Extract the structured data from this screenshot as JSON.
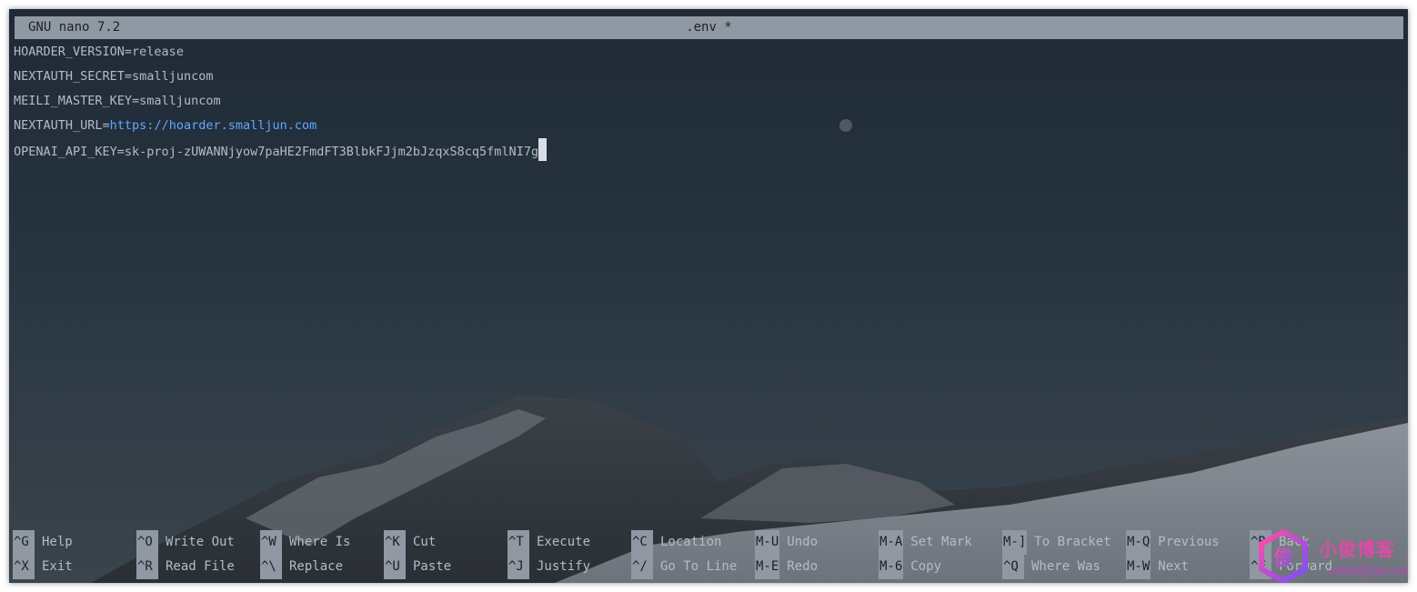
{
  "titlebar": {
    "app": "GNU nano 7.2",
    "file": ".env *"
  },
  "editor": {
    "lines": [
      {
        "key": "HOARDER_VERSION=",
        "value": "release"
      },
      {
        "key": "NEXTAUTH_SECRET=",
        "value": "smalljuncom"
      },
      {
        "key": "MEILI_MASTER_KEY=",
        "value": "smalljuncom"
      },
      {
        "key": "NEXTAUTH_URL=",
        "value": "https://hoarder.smalljun.com"
      },
      {
        "key": "OPENAI_API_KEY=",
        "value": "sk-proj-zUWANNjyow7paHE2FmdFT3BlbkFJjm2bJzqxS8cq5fmlNI7g"
      }
    ]
  },
  "shortcuts": {
    "row1": [
      {
        "key": "^G",
        "label": "Help"
      },
      {
        "key": "^O",
        "label": "Write Out"
      },
      {
        "key": "^W",
        "label": "Where Is"
      },
      {
        "key": "^K",
        "label": "Cut"
      },
      {
        "key": "^T",
        "label": "Execute"
      },
      {
        "key": "^C",
        "label": "Location"
      },
      {
        "key": "M-U",
        "label": "Undo"
      },
      {
        "key": "M-A",
        "label": "Set Mark"
      },
      {
        "key": "M-]",
        "label": "To Bracket"
      },
      {
        "key": "M-Q",
        "label": "Previous"
      },
      {
        "key": "^B",
        "label": "Back"
      }
    ],
    "row2": [
      {
        "key": "^X",
        "label": "Exit"
      },
      {
        "key": "^R",
        "label": "Read File"
      },
      {
        "key": "^\\",
        "label": "Replace"
      },
      {
        "key": "^U",
        "label": "Paste"
      },
      {
        "key": "^J",
        "label": "Justify"
      },
      {
        "key": "^/",
        "label": "Go To Line"
      },
      {
        "key": "M-E",
        "label": "Redo"
      },
      {
        "key": "M-6",
        "label": "Copy"
      },
      {
        "key": "^Q",
        "label": "Where Was"
      },
      {
        "key": "M-W",
        "label": "Next"
      },
      {
        "key": "^F",
        "label": "Forward"
      }
    ]
  },
  "watermark": {
    "title": "小俊博客",
    "domain": "smalljun.com",
    "logo_letter": "俊"
  },
  "colors": {
    "bar": "#8f98a3",
    "text": "#b4bcc6",
    "url": "#5fa8ff",
    "background": "#25323d",
    "watermark": "#e14aa6"
  }
}
